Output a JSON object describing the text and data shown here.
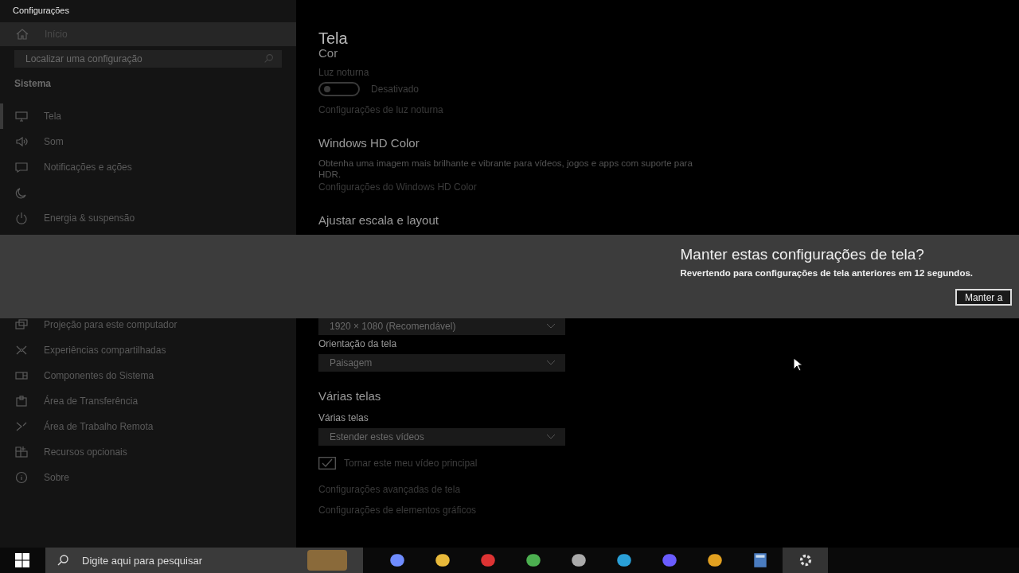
{
  "window": {
    "title": "Configurações"
  },
  "sidebar": {
    "home": "Início",
    "search": {
      "placeholder": "Localizar uma configuração"
    },
    "section": "Sistema",
    "items_top": [
      {
        "label": "Tela",
        "selected": true
      },
      {
        "label": "Som",
        "selected": false
      },
      {
        "label": "Notificações e ações",
        "selected": false
      },
      {
        "selected": false
      },
      {
        "label": "Energia & suspensão",
        "selected": false
      }
    ],
    "items_bottom": [
      {
        "label": "Projeção para este computador",
        "selected": false
      },
      {
        "label": "Experiências compartilhadas",
        "selected": false
      },
      {
        "label": "Componentes do Sistema",
        "selected": false
      },
      {
        "label": "Área de Transferência",
        "selected": false
      },
      {
        "label": "Área de Trabalho Remota",
        "selected": false
      },
      {
        "label": "Recursos opcionais",
        "selected": false
      },
      {
        "label": "Sobre",
        "selected": false
      }
    ]
  },
  "content": {
    "title": "Tela",
    "subtitle": "Cor",
    "night_light": {
      "label": "Luz noturna",
      "on": false,
      "state": "Desativado",
      "link": "Configurações de luz noturna"
    },
    "hd": {
      "heading": "Windows HD Color",
      "text": "Obtenha uma imagem mais brilhante e vibrante para vídeos, jogos e apps com suporte para HDR.",
      "link": "Configurações do Windows HD Color"
    },
    "scale": {
      "heading": "Ajustar escala e layout",
      "resolution": "1920 × 1080 (Recomendável)",
      "orientation_label": "Orientação da tela",
      "orientation": "Paisagem"
    },
    "multi": {
      "heading": "Várias telas",
      "label": "Várias telas",
      "value": "Estender estes vídeos",
      "checkbox": {
        "label": "Tornar este meu vídeo principal",
        "checked": true
      },
      "links": [
        "Configurações avançadas de tela",
        "Configurações de elementos gráficos"
      ]
    }
  },
  "dialog": {
    "title": "Manter estas configurações de tela?",
    "message": "Revertendo para configurações de tela anteriores em 12 segundos.",
    "button": "Manter a"
  },
  "taskbar": {
    "search": {
      "placeholder": "Digite aqui para pesquisar"
    },
    "apps": [
      {
        "selected": false
      },
      {
        "selected": false
      },
      {
        "selected": false
      },
      {
        "selected": false
      },
      {
        "selected": false
      },
      {
        "selected": false
      },
      {
        "selected": false
      },
      {
        "selected": false
      },
      {
        "selected": false
      },
      {
        "selected": true
      }
    ]
  }
}
